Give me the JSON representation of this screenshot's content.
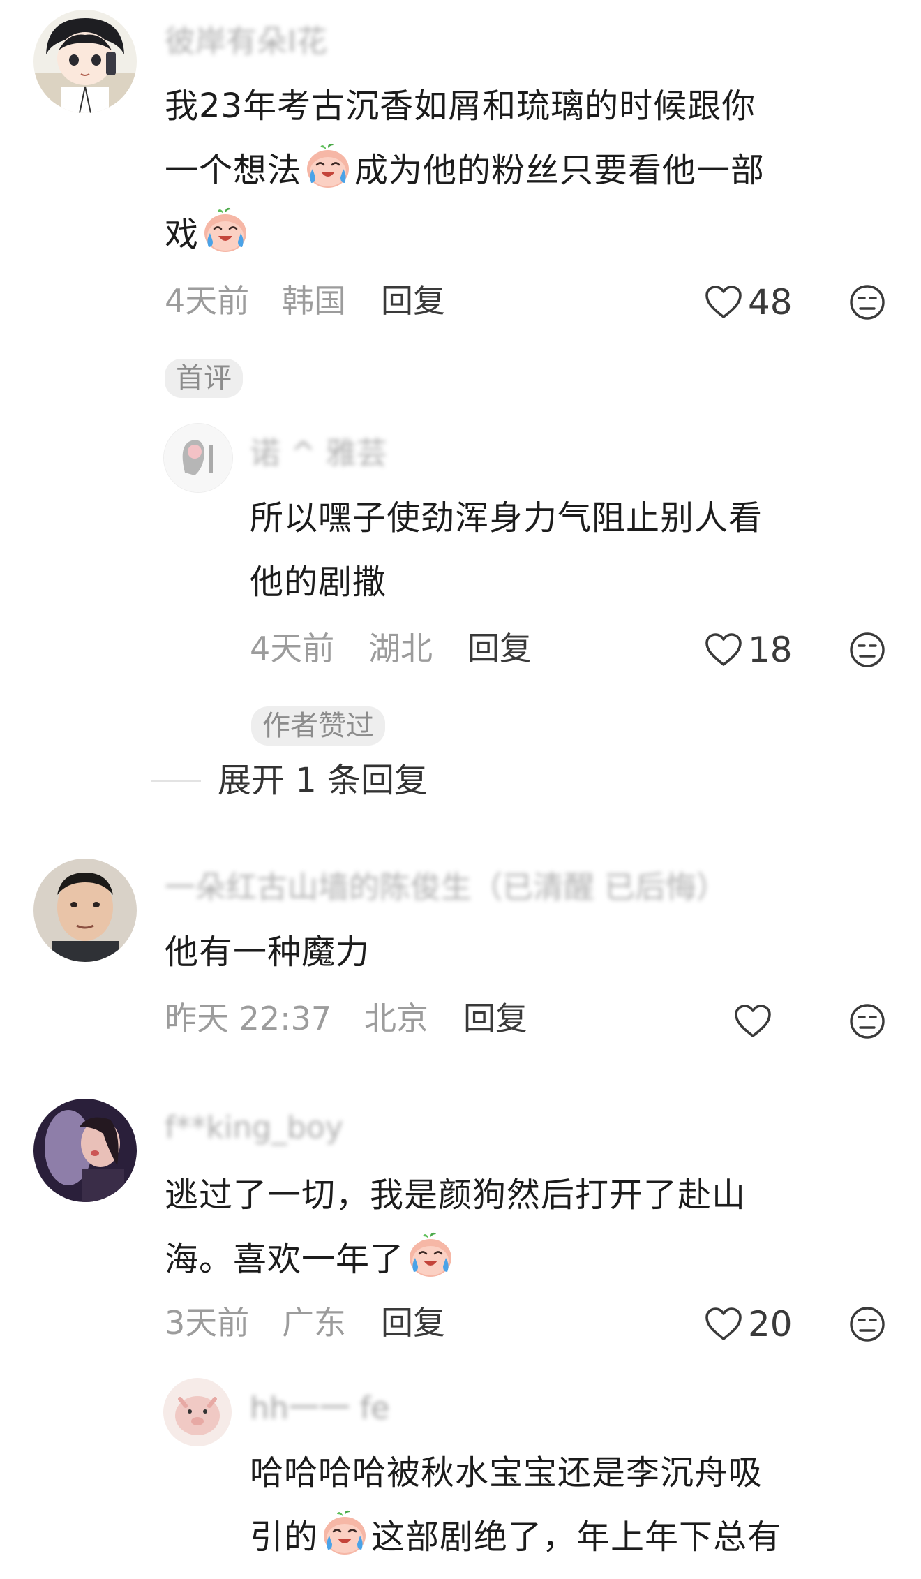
{
  "comments": [
    {
      "username": "彼岸有朵Ⅰ花",
      "text_line1": "我23年考古沉香如屑和琉璃的时候跟你",
      "text_line2a": "一个想法",
      "text_line2b": "成为他的粉丝只要看他一部",
      "text_line3": "戏",
      "time": "4天前",
      "location": "韩国",
      "reply": "回复",
      "likes": "48",
      "badge": "首评",
      "avatar_icon": "anime-boy-avatar",
      "replies": [
        {
          "username": "诺 ^ 雅芸",
          "text_line1": "所以嘿子使劲浑身力气阻止别人看",
          "text_line2": "他的剧撒",
          "time": "4天前",
          "location": "湖北",
          "reply": "回复",
          "likes": "18",
          "badge": "作者赞过",
          "avatar_icon": "girl-sketch-avatar"
        }
      ],
      "expand": "展开 1 条回复"
    },
    {
      "username": "一朵红古山墙的陈俊生（已清醒 已后悔）",
      "text_line1": "他有一种魔力",
      "time": "昨天 22:37",
      "location": "北京",
      "reply": "回复",
      "likes": "",
      "avatar_icon": "man-photo-avatar"
    },
    {
      "username": "f**king_boy",
      "text_line1": "逃过了一切，我是颜狗然后打开了赴山",
      "text_line2": "海。喜欢一年了",
      "time": "3天前",
      "location": "广东",
      "reply": "回复",
      "likes": "20",
      "avatar_icon": "concert-photo-avatar",
      "replies": [
        {
          "username": "hh一一 fe",
          "text_line1": "哈哈哈哈被秋水宝宝还是李沉舟吸",
          "text_line2": "引的",
          "text_line2b": "这部剧绝了，年上年下总有",
          "avatar_icon": "pig-cartoon-avatar"
        }
      ]
    }
  ],
  "icons": {
    "like": "heart-outline-icon",
    "dislike": "meh-face-icon",
    "emoji": "crying-peach-emoji"
  },
  "colors": {
    "meta": "#9c9c9c",
    "text": "#1c1c1c",
    "badge_bg": "#eeeeee"
  }
}
